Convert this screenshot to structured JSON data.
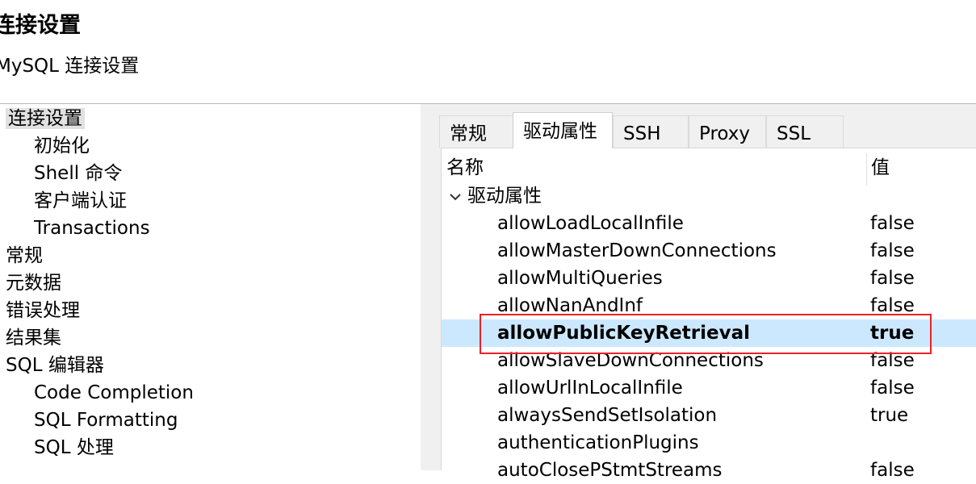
{
  "header": {
    "title": "连接设置",
    "subtitle": "MySQL 连接设置"
  },
  "tree": [
    {
      "label": "连接设置",
      "level": 0,
      "selected": true
    },
    {
      "label": "初始化",
      "level": 1
    },
    {
      "label": "Shell 命令",
      "level": 1
    },
    {
      "label": "客户端认证",
      "level": 1
    },
    {
      "label": "Transactions",
      "level": 1
    },
    {
      "label": "常规",
      "level": 0
    },
    {
      "label": "元数据",
      "level": 0
    },
    {
      "label": "错误处理",
      "level": 0
    },
    {
      "label": "结果集",
      "level": 0
    },
    {
      "label": "SQL 编辑器",
      "level": 0
    },
    {
      "label": "Code Completion",
      "level": 1
    },
    {
      "label": "SQL Formatting",
      "level": 1
    },
    {
      "label": "SQL 处理",
      "level": 1
    }
  ],
  "tabs": [
    {
      "label": "常规",
      "active": false
    },
    {
      "label": "驱动属性",
      "active": true
    },
    {
      "label": "SSH",
      "active": false
    },
    {
      "label": "Proxy",
      "active": false
    },
    {
      "label": "SSL",
      "active": false
    }
  ],
  "table": {
    "col_name": "名称",
    "col_value": "值",
    "group_label": "驱动属性",
    "rows": [
      {
        "name": "allowLoadLocalInfile",
        "value": "false"
      },
      {
        "name": "allowMasterDownConnections",
        "value": "false"
      },
      {
        "name": "allowMultiQueries",
        "value": "false"
      },
      {
        "name": "allowNanAndInf",
        "value": "false"
      },
      {
        "name": "allowPublicKeyRetrieval",
        "value": "true",
        "selected": true
      },
      {
        "name": "allowSlaveDownConnections",
        "value": "false"
      },
      {
        "name": "allowUrlInLocalInfile",
        "value": "false"
      },
      {
        "name": "alwaysSendSetIsolation",
        "value": "true"
      },
      {
        "name": "authenticationPlugins",
        "value": ""
      },
      {
        "name": "autoClosePStmtStreams",
        "value": "false"
      }
    ]
  },
  "colors": {
    "selection": "#cce8ff",
    "highlight_border": "#e8222a",
    "tree_selection": "#e1e1e1"
  }
}
